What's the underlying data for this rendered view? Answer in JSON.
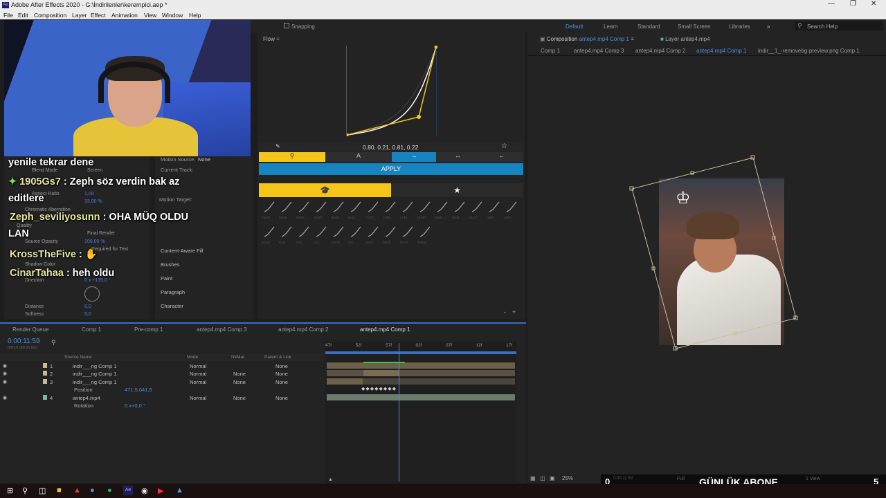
{
  "window": {
    "title": "Adobe After Effects 2020 - G:\\İndirilenler\\kerempici.aep *",
    "app_icon": "Ae"
  },
  "menu": [
    "File",
    "Edit",
    "Composition",
    "Layer",
    "Effect",
    "Animation",
    "View",
    "Window",
    "Help"
  ],
  "toolbar": {
    "snapping": "Snapping",
    "workspaces": [
      "Default",
      "Learn",
      "Standard",
      "Small Screen",
      "Libraries"
    ],
    "search_placeholder": "Search Help"
  },
  "chat": [
    {
      "user": "",
      "msg": "yenile tekrar dene"
    },
    {
      "user": "1905Gs7",
      "msg": ": Zeph söz verdin bak az"
    },
    {
      "user": "",
      "msg": "editlere"
    },
    {
      "user": "Zeph_seviliyosunn",
      "msg": ": OHA MÜQ OLDU"
    },
    {
      "user": "",
      "msg": "LAN"
    },
    {
      "user": "KrossTheFive",
      "msg": ":"
    },
    {
      "user": "CinarTahaa",
      "msg": ": heh oldu"
    }
  ],
  "effects_panel": {
    "blend_mode_label": "Blend Mode",
    "blend_mode_val": "Screen",
    "aspect_label": "Aspect Ratio",
    "aspect_val": "1,00",
    "aspect_val2": "33,00 %",
    "chromatic": "Chromatic Aberration",
    "quality": "Quality",
    "render": "Final Render",
    "src_opacity": "Source Opacity",
    "src_opacity_val": "100,00 %",
    "required": "Required for Text",
    "shadow": "Shadow Color",
    "direction": "Direction",
    "direction_val": "0 x +135,0 °",
    "distance": "Distance",
    "distance_val": "8,0",
    "softness": "Softness",
    "softness_val": "9,0"
  },
  "mid_panel": {
    "motion_source": "Motion Source:",
    "motion_source_val": "None",
    "current_track": "Current Track:",
    "motion_target": "Motion Target:",
    "items": [
      "Content-Aware Fill",
      "Brushes",
      "Paint",
      "Paragraph",
      "Character"
    ]
  },
  "flow": {
    "title": "Flow",
    "values": "0.80, 0.21, 0.81, 0.22",
    "apply": "APPLY",
    "presets_row1": [
      "ease",
      "ease…",
      "ease…",
      "quad",
      "quad…",
      "qua…",
      "cubic",
      "cubi…",
      "cubi…",
      "quart",
      "quar…",
      "quar…",
      "quint",
      "quin…",
      "quin…"
    ],
    "presets_row2": [
      "expo",
      "exp…",
      "exp…",
      "circ",
      "circIn",
      "circ…",
      "back",
      "back…",
      "back…",
      "linear"
    ]
  },
  "comp": {
    "panel_title": "Composition",
    "panel_comp": "antep4.mp4 Comp 1",
    "layer_title": "Layer antep4.mp4",
    "breadcrumbs": [
      "Comp 1",
      "antep4.mp4 Comp 3",
      "antep4.mp4 Comp 2",
      "antep4.mp4 Comp 1",
      "indir__1_-removebg-preview.png Comp 1"
    ],
    "zoom": "25%",
    "timecode": "0:00:11:59",
    "quality": "Full",
    "view": "1 View"
  },
  "timeline": {
    "tabs": [
      "Render Queue",
      "Comp 1",
      "Pre-comp 1",
      "antep4.mp4 Comp 3",
      "antep4.mp4 Comp 2",
      "antep4.mp4 Comp 1"
    ],
    "timecode": "0:00:11:59",
    "frames": "00719 (60.00 fps)",
    "columns": [
      "Source Name",
      "Mode",
      "TrkMat",
      "Parent & Link"
    ],
    "ruler": [
      "47f",
      "52f",
      "57f",
      "02f",
      "07f",
      "12f",
      "17f"
    ],
    "layers": [
      {
        "num": "1",
        "name": "indir___ng Comp 1",
        "mode": "Normal",
        "trk": "",
        "parent": "None"
      },
      {
        "num": "2",
        "name": "indir___ng Comp 1",
        "mode": "Normal",
        "trk": "None",
        "parent": "None"
      },
      {
        "num": "3",
        "name": "indir___ng Comp 1",
        "mode": "Normal",
        "trk": "None",
        "parent": "None"
      },
      {
        "num": "",
        "name": "Position",
        "mode": "471,5,641,5",
        "trk": "",
        "parent": ""
      },
      {
        "num": "4",
        "name": "antep4.mp4",
        "mode": "Normal",
        "trk": "None",
        "parent": "None"
      },
      {
        "num": "",
        "name": "Rotation",
        "mode": "0 x+0,0 °",
        "trk": "",
        "parent": ""
      }
    ]
  },
  "overlay": {
    "left_num": "0",
    "title": "GÜNLÜK ABONE",
    "right_num": "5"
  },
  "colors": {
    "accent_blue": "#1584c0",
    "flow_yellow": "#f5c518",
    "ae_purple": "#1e1e5a",
    "timeline_blue": "#3a6fc4"
  }
}
